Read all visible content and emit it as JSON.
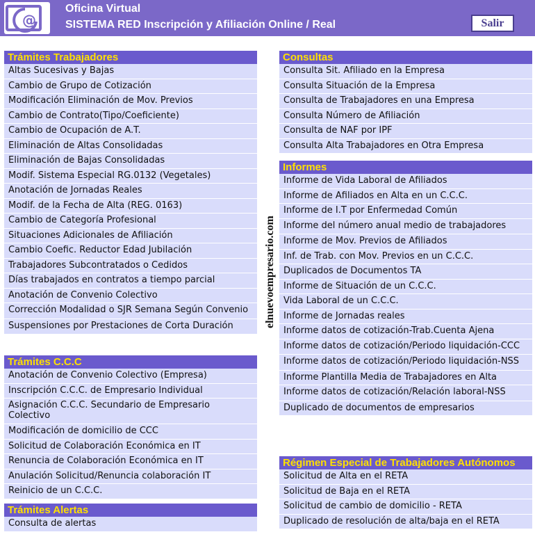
{
  "header": {
    "line1": "Oficina Virtual",
    "line2": "SISTEMA RED Inscripción y Afiliación Online / Real",
    "exit_label": "Salir"
  },
  "watermark": "elnuevoempresario.com",
  "colors": {
    "header_bg": "#7b68c8",
    "section_header_bg": "#6a5acd",
    "section_header_text": "#ffe000",
    "item_bg": "#d9dcfb"
  },
  "sections": {
    "tramites_trabajadores": {
      "title": "Trámites Trabajadores",
      "items": [
        "Altas Sucesivas y Bajas",
        "Cambio de Grupo de Cotización",
        "Modificación Eliminación de Mov. Previos",
        "Cambio de Contrato(Tipo/Coeficiente)",
        "Cambio de Ocupación de A.T.",
        "Eliminación de Altas Consolidadas",
        "Eliminación de Bajas Consolidadas",
        "Modif. Sistema Especial RG.0132 (Vegetales)",
        "Anotación de Jornadas Reales",
        "Modif. de la Fecha de Alta (REG. 0163)",
        "Cambio de Categoría Profesional",
        "Situaciones Adicionales de Afiliación",
        "Cambio Coefic. Reductor Edad Jubilación",
        "Trabajadores Subcontratados o Cedidos",
        "Días trabajados en contratos a tiempo parcial",
        "Anotación de Convenio Colectivo",
        "Corrección Modalidad o SJR Semana Según Convenio",
        "Suspensiones por Prestaciones de Corta Duración"
      ]
    },
    "tramites_ccc": {
      "title": "Trámites C.C.C",
      "items": [
        "Anotación de Convenio Colectivo (Empresa)",
        "Inscripción C.C.C. de Empresario Individual",
        "Asignación C.C.C. Secundario de Empresario Colectivo",
        "Modificación de domicilio de CCC",
        "Solicitud de Colaboración Económica en IT",
        "Renuncia de Colaboración Económica en IT",
        "Anulación Solicitud/Renuncia colaboración IT",
        "Reinicio de un C.C.C."
      ]
    },
    "tramites_alertas": {
      "title": "Trámites Alertas",
      "items": [
        "Consulta de alertas"
      ]
    },
    "consultas": {
      "title": "Consultas",
      "items": [
        "Consulta Sit. Afiliado en la Empresa",
        "Consulta Situación de la Empresa",
        "Consulta de Trabajadores en una Empresa",
        "Consulta Número de Afiliación",
        "Consulta de NAF por IPF",
        "Consulta Alta Trabajadores en Otra Empresa"
      ]
    },
    "informes": {
      "title": "Informes",
      "items": [
        "Informe de Vida Laboral de Afiliados",
        "Informe de Afiliados en Alta en un C.C.C.",
        "Informe de I.T por Enfermedad Común",
        "Informe del número anual medio de trabajadores",
        "Informe de Mov. Previos de Afiliados",
        "Inf. de Trab. con Mov. Previos en un C.C.C.",
        "Duplicados de Documentos TA",
        "Informe de Situación de un C.C.C.",
        "Vida Laboral de un C.C.C.",
        "Informe de Jornadas reales",
        "Informe datos de cotización-Trab.Cuenta Ajena",
        "Informe datos de cotización/Periodo liquidación-CCC",
        "Informe datos de cotización/Periodo liquidación-NSS",
        "Informe Plantilla Media de Trabajadores en Alta",
        "Informe datos de cotización/Relación laboral-NSS",
        "Duplicado de documentos de empresarios"
      ]
    },
    "reta": {
      "title": "Régimen Especial de Trabajadores Autónomos",
      "items": [
        "Solicitud de Alta en el RETA",
        "Solicitud de Baja en el RETA",
        "Solicitud de cambio de domicilio - RETA",
        "Duplicado de resolución de alta/baja en el RETA"
      ]
    }
  }
}
